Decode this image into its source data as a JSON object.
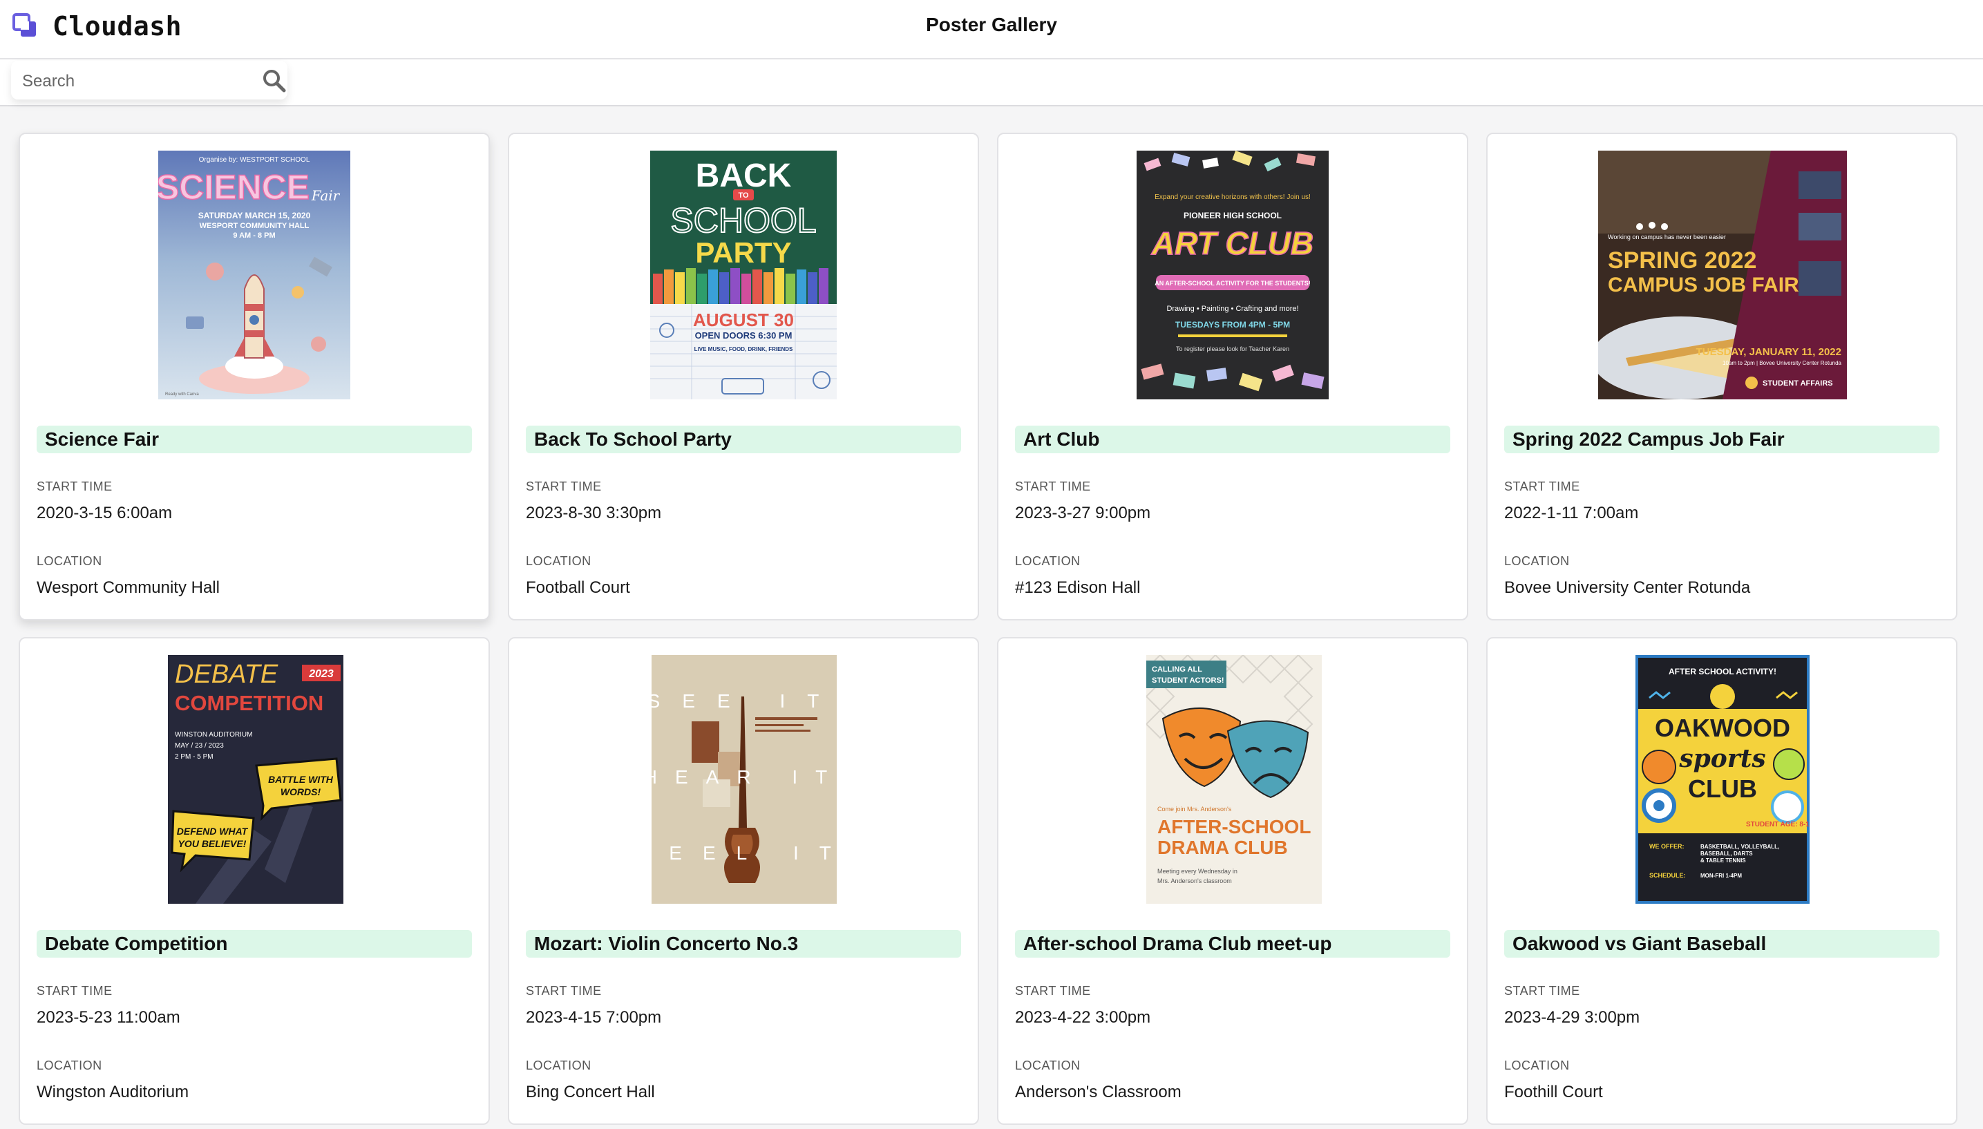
{
  "app": {
    "name": "Cloudash",
    "page_title": "Poster Gallery"
  },
  "search": {
    "placeholder": "Search"
  },
  "labels": {
    "start_time": "START TIME",
    "location": "LOCATION"
  },
  "events": [
    {
      "title": "Science Fair",
      "start_time": "2020-3-15 6:00am",
      "location": "Wesport Community Hall"
    },
    {
      "title": "Back To School Party",
      "start_time": "2023-8-30 3:30pm",
      "location": "Football Court"
    },
    {
      "title": "Art Club",
      "start_time": "2023-3-27 9:00pm",
      "location": "#123 Edison Hall"
    },
    {
      "title": "Spring 2022 Campus Job Fair",
      "start_time": "2022-1-11 7:00am",
      "location": "Bovee University Center Rotunda"
    },
    {
      "title": "Debate Competition",
      "start_time": "2023-5-23 11:00am",
      "location": "Wingston Auditorium"
    },
    {
      "title": "Mozart: Violin Concerto No.3",
      "start_time": "2023-4-15 7:00pm",
      "location": "Bing Concert Hall"
    },
    {
      "title": "After-school Drama Club meet-up",
      "start_time": "2023-4-22 3:00pm",
      "location": "Anderson's Classroom"
    },
    {
      "title": "Oakwood vs Giant Baseball",
      "start_time": "2023-4-29 3:00pm",
      "location": "Foothill Court"
    }
  ],
  "posters": {
    "science": {
      "org": "Organise by: WESTPORT SCHOOL",
      "headline": "SCIENCE",
      "tag": "Fair",
      "date": "SATURDAY MARCH 15, 2020",
      "venue": "WESPORT COMMUNITY HALL",
      "hours": "9 AM - 8 PM"
    },
    "school": {
      "line1": "BACK",
      "to": "TO",
      "line2": "SCHOOL",
      "line3": "PARTY",
      "date": "AUGUST 30",
      "doors": "OPEN DOORS 6:30 PM",
      "extras": "LIVE MUSIC, FOOD, DRINK, FRIENDS"
    },
    "art": {
      "tagline": "Expand your creative horizons with others!  Join us!",
      "school": "PIONEER HIGH SCHOOL",
      "headline": "ART CLUB",
      "strip": "AN AFTER-SCHOOL ACTIVITY FOR THE STUDENTS!",
      "activities": "Drawing • Painting • Crafting and more!",
      "hours": "TUESDAYS FROM 4PM - 5PM",
      "register": "To register please look for Teacher Karen"
    },
    "jobfair": {
      "working": "Working on campus has never been easier",
      "line1": "SPRING 2022",
      "line2": "CAMPUS JOB FAIR",
      "date": "TUESDAY, JANUARY 11, 2022",
      "time": "10am to 2pm | Bovee University Center Rotunda",
      "brand": "STUDENT AFFAIRS"
    },
    "debate": {
      "line1": "DEBATE",
      "year": "2023",
      "line2": "COMPETITION",
      "venue": "WINSTON AUDITORIUM",
      "date": "MAY / 23 / 2023",
      "time": "2 PM - 5 PM",
      "bubble1a": "BATTLE WITH",
      "bubble1b": "WORDS!",
      "bubble2a": "DEFEND WHAT",
      "bubble2b": "YOU BELIEVE!"
    },
    "mozart": {
      "row1": "SEE IT",
      "row2": "HEAR IT",
      "row3": "FEEL IT"
    },
    "drama": {
      "badge1": "CALLING ALL",
      "badge2": "STUDENT ACTORS!",
      "intro": "Come join Mrs. Anderson's",
      "line1": "AFTER-SCHOOL",
      "line2": "DRAMA CLUB",
      "meet1": "Meeting every Wednesday in",
      "meet2": "Mrs. Anderson's classroom"
    },
    "sports": {
      "top": "AFTER SCHOOL ACTIVITY!",
      "line1": "OAKWOOD",
      "line2": "sports",
      "line3": "CLUB",
      "age": "STUDENT AGE: 8-18",
      "offer_label": "WE OFFER:",
      "offer1": "BASKETBALL, VOLLEYBALL,",
      "offer2": "BASEBALL, DARTS",
      "offer3": "& TABLE TENNIS",
      "schedule_label": "SCHEDULE:",
      "schedule": "MON-FRI 1-4PM"
    }
  },
  "colors": {
    "title_bg": "#dcf7e8",
    "brand_icon": "#5b4fd6"
  }
}
